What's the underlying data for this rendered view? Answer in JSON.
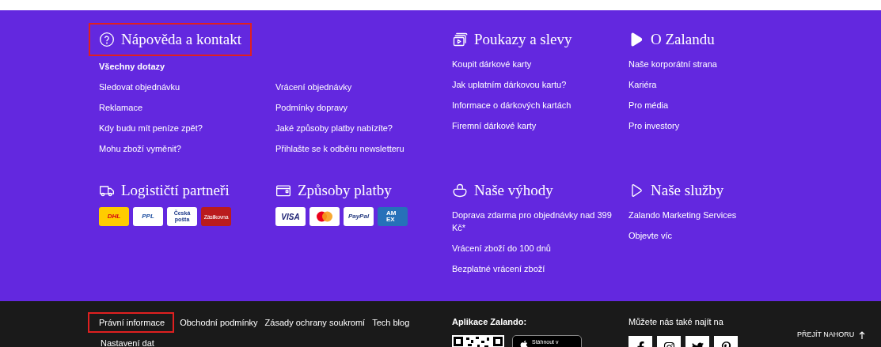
{
  "help": {
    "title": "Nápověda a kontakt",
    "highlighted": true,
    "columns": [
      [
        {
          "label": "Všechny dotazy",
          "bold": true
        },
        {
          "label": "Sledovat objednávku",
          "bold": false
        },
        {
          "label": "Reklamace",
          "bold": false
        },
        {
          "label": "Kdy budu mít peníze zpět?",
          "bold": false
        },
        {
          "label": "Mohu zboží vyměnit?",
          "bold": false
        }
      ],
      [
        {
          "label": "Vrácení objednávky",
          "bold": false
        },
        {
          "label": "Podmínky dopravy",
          "bold": false
        },
        {
          "label": "Jaké způsoby platby nabízíte?",
          "bold": false
        },
        {
          "label": "Přihlašte se k odběru newsletteru",
          "bold": false
        }
      ]
    ]
  },
  "vouchers": {
    "title": "Poukazy a slevy",
    "items": [
      "Koupit dárkové karty",
      "Jak uplatním dárkovou kartu?",
      "Informace o dárkových kartách",
      "Firemní dárkové karty"
    ]
  },
  "about": {
    "title": "O Zalandu",
    "items": [
      "Naše korporátní strana",
      "Kariéra",
      "Pro média",
      "Pro investory"
    ]
  },
  "logistics": {
    "title": "Logističtí partneři",
    "logos": [
      {
        "kind": "dhl",
        "label": "DHL"
      },
      {
        "kind": "ppl",
        "label": "PPL"
      },
      {
        "kind": "posta",
        "label": "Česká pošta"
      },
      {
        "kind": "zasilkovna",
        "label": "Zásilkovna"
      }
    ]
  },
  "payment": {
    "title": "Způsoby platby",
    "logos": [
      {
        "kind": "visa",
        "label": "VISA"
      },
      {
        "kind": "mastercard"
      },
      {
        "kind": "paypal",
        "label": "PayPal"
      },
      {
        "kind": "amex",
        "label": "AMEX"
      }
    ]
  },
  "benefits": {
    "title": "Naše výhody",
    "items": [
      "Doprava zdarma pro objednávky nad 399 Kč*",
      "Vrácení zboží do 100 dnů",
      "Bezplatné vrácení zboží"
    ]
  },
  "services": {
    "title": "Naše služby",
    "items": [
      "Zalando Marketing Services",
      "Objevte víc"
    ]
  },
  "bottom": {
    "links": [
      {
        "label": "Právní informace",
        "highlighted": true
      },
      {
        "label": "Obchodní podmínky",
        "highlighted": false
      },
      {
        "label": "Zásady ochrany soukromí",
        "highlighted": false
      },
      {
        "label": "Tech blog",
        "highlighted": false
      },
      {
        "label": "Nastavení dat",
        "highlighted": false
      }
    ],
    "app": {
      "title": "Aplikace Zalando:",
      "badge": "Stáhnout v"
    },
    "social": {
      "title": "Můžete nás také najít na"
    },
    "back_to_top": "PŘEJÍT NAHORU"
  }
}
